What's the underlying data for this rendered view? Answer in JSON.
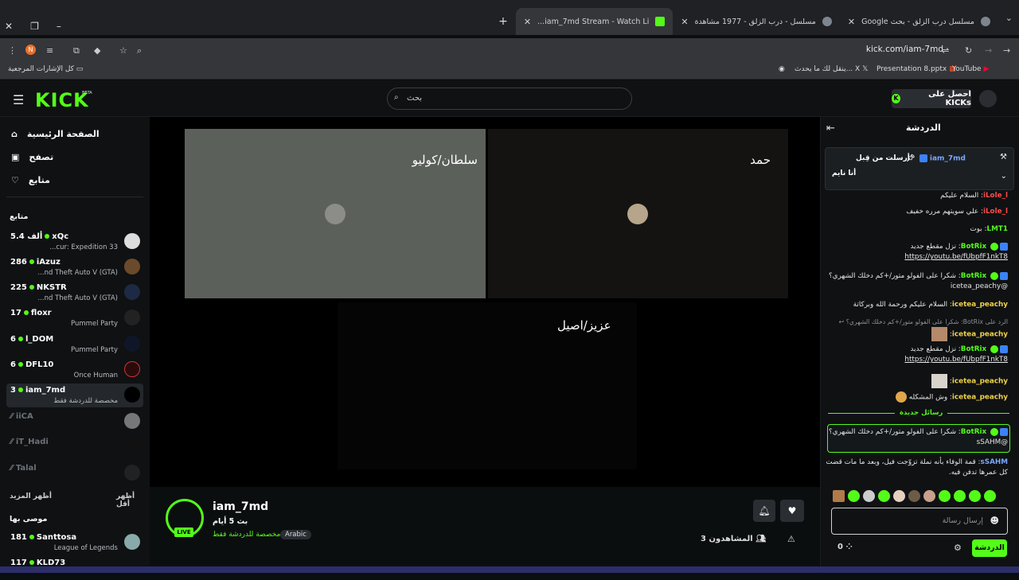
{
  "browser": {
    "tabs": [
      {
        "title": "مسلسل درب الزلق - بحث Google"
      },
      {
        "title": "مسلسل - درب الزلق - 1977 مشاهدة"
      },
      {
        "title": "iam_7md Stream - Watch Li..."
      }
    ],
    "url": "kick.com/iam-7md",
    "bookmarks": {
      "all": "كل الإشارات المرجعية",
      "x_post": "ينقل لك ما يحدث... X",
      "ppt": "Presentation 8.pptx",
      "youtube": "YouTube"
    },
    "profile_initial": "N"
  },
  "header": {
    "logo": "KICK",
    "beta": "BETA",
    "search_placeholder": "بحث",
    "get_kicks": "احصل على KICKs"
  },
  "sidebar": {
    "nav": [
      {
        "label": "الصفحة الرئيسية",
        "icon": "home-icon"
      },
      {
        "label": "تصفح",
        "icon": "browse-icon"
      },
      {
        "label": "متابع",
        "icon": "heart-icon"
      }
    ],
    "following_title": "متابع",
    "following": [
      {
        "viewers": "5.4 ألف",
        "name": "xQc",
        "category": "...cur: Expedition 33"
      },
      {
        "viewers": "286",
        "name": "iAzuz",
        "category": "...nd Theft Auto V (GTA)"
      },
      {
        "viewers": "225",
        "name": "NKSTR",
        "category": "...nd Theft Auto V (GTA)"
      },
      {
        "viewers": "17",
        "name": "floxr",
        "category": "Pummel Party"
      },
      {
        "viewers": "6",
        "name": "l_DOM",
        "category": "Pummel Party"
      },
      {
        "viewers": "6",
        "name": "DFL10",
        "category": "Once Human"
      },
      {
        "viewers": "3",
        "name": "iam_7md",
        "category": "مخصصة للدردشة فقط"
      }
    ],
    "offline": [
      "iiCA",
      "iT_Hadi",
      "Talal"
    ],
    "show_more": "أظهر المزيد",
    "show_less": "أظهر أقل",
    "recommended_title": "موصى بها",
    "recommended": [
      {
        "viewers": "181",
        "name": "Santtosa",
        "category": "League of Legends"
      },
      {
        "viewers": "117",
        "name": "KLD73",
        "category": ""
      }
    ]
  },
  "player": {
    "tiles": [
      "سلطان/كوليو",
      "حمد",
      "عزيز/اصيل"
    ]
  },
  "stream": {
    "username": "iam_7md",
    "live": "LIVE",
    "since": "بث 5 أيام",
    "title": "مخصصة للدردشة فقط",
    "tag": "Arabic",
    "viewers": "3 المشاهدون"
  },
  "chat": {
    "title": "الدردشة",
    "pinned": {
      "user": "iam_7md",
      "label": "أرسلت من قِبل",
      "text": "أنا نايم"
    },
    "messages": [
      {
        "user": "iLole_l",
        "text": "السلام عليكم"
      },
      {
        "user": "iLole_l",
        "text": "علي سويتهم مرره خفيف"
      },
      {
        "user": "LMT1",
        "text": "بوت"
      },
      {
        "user": "BotRix",
        "text": "نزل مقطع جديد",
        "link": "https://youtu.be/fUbpfF1nkT8"
      },
      {
        "user": "BotRix",
        "text": "شكرا على الفولو متور/+كم دخلك الشهري؟",
        "mention": "@icetea_peachy"
      },
      {
        "user": "icetea_peachy",
        "text": "السلام عليكم ورحمة الله وبركاتة"
      },
      {
        "reply": "الرد على BotRix: شكرا على الفولو متور/+كم دخلك الشهري؟"
      },
      {
        "user": "icetea_peachy",
        "text": ""
      },
      {
        "user": "BotRix",
        "text": "نزل مقطع جديد",
        "link": "https://youtu.be/fUbpfF1nkT8"
      },
      {
        "user": "icetea_peachy",
        "text": ""
      },
      {
        "user": "icetea_peachy",
        "text": "وش المشكله"
      }
    ],
    "new_messages": "رسائل جديدة",
    "highlight": {
      "user": "BotRix",
      "text": "شكرا على الفولو متور/+كم دخلك الشهري؟",
      "mention": "@sSAHM"
    },
    "last": {
      "user": "sSAHM",
      "text": "قمة الوفاء بأنه نملة تزوّجت فيل، وبعد ما مات قضت كل عمرها تدفن فيه."
    },
    "input_placeholder": "إرسال رسالة",
    "send_label": "الدردشة",
    "points": "0"
  }
}
